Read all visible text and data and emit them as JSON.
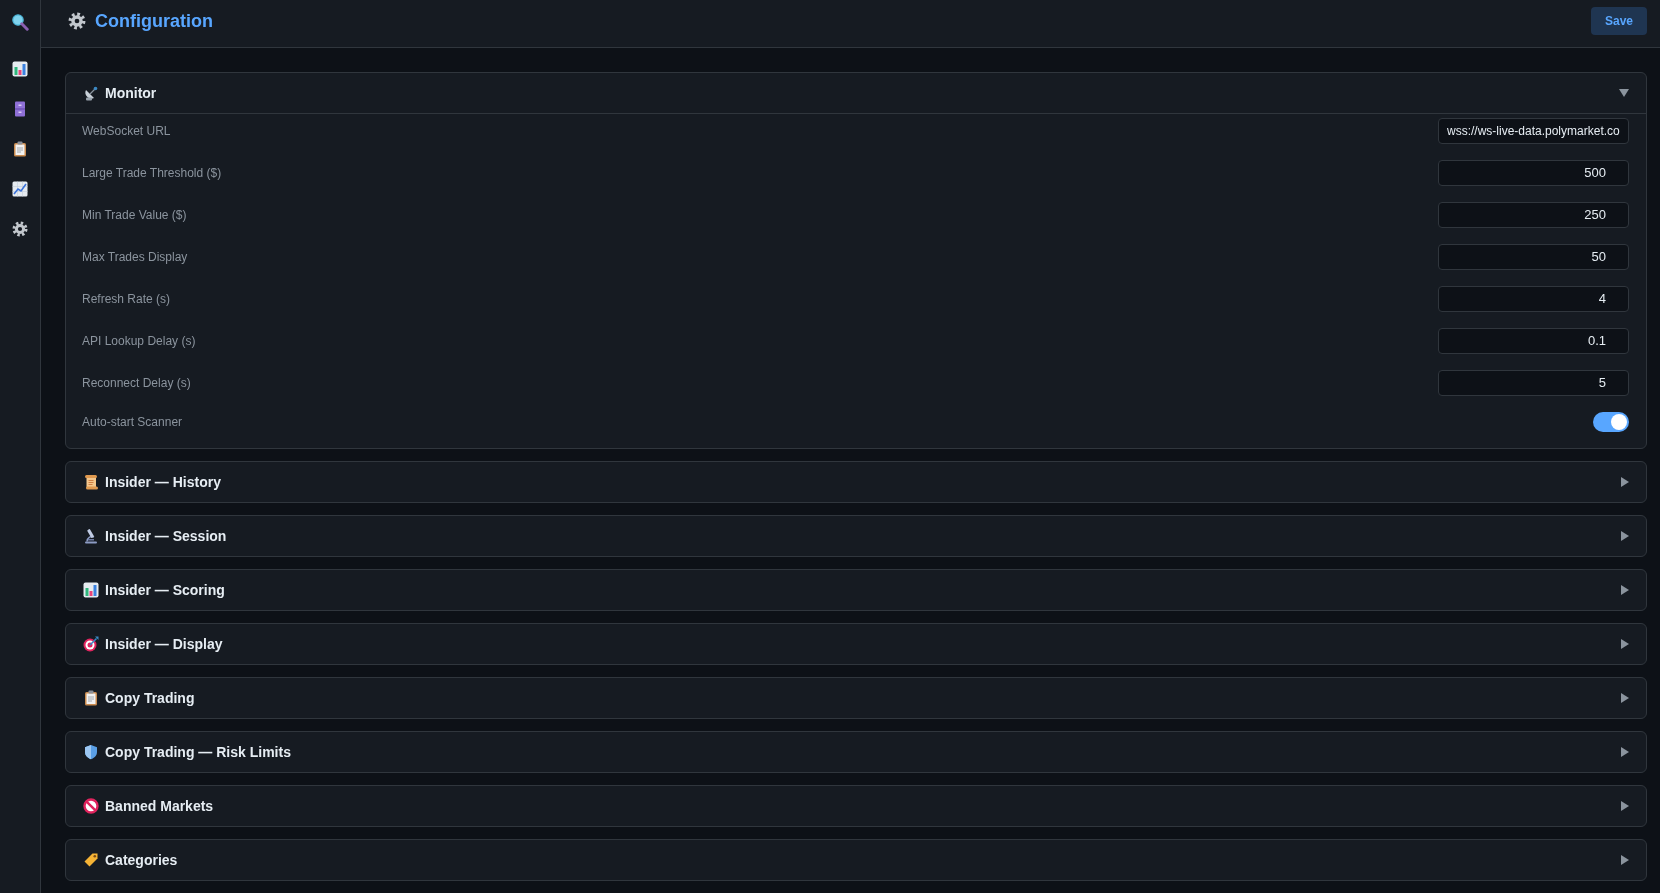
{
  "header": {
    "title": "Configuration",
    "save_button": "Save"
  },
  "sections": [
    {
      "title": "Monitor",
      "expanded": true,
      "fields": [
        {
          "kind": "text",
          "label": "WebSocket URL",
          "value": "wss://ws-live-data.polymarket.co"
        },
        {
          "kind": "number",
          "label": "Large Trade Threshold ($)",
          "value": "500"
        },
        {
          "kind": "number",
          "label": "Min Trade Value ($)",
          "value": "250"
        },
        {
          "kind": "number",
          "label": "Max Trades Display",
          "value": "50"
        },
        {
          "kind": "number",
          "label": "Refresh Rate (s)",
          "value": "4"
        },
        {
          "kind": "number",
          "label": "API Lookup Delay (s)",
          "value": "0.1"
        },
        {
          "kind": "number",
          "label": "Reconnect Delay (s)",
          "value": "5"
        },
        {
          "kind": "toggle",
          "label": "Auto-start Scanner",
          "on": true
        }
      ]
    },
    {
      "title": "Insider — History",
      "expanded": false
    },
    {
      "title": "Insider — Session",
      "expanded": false
    },
    {
      "title": "Insider — Scoring",
      "expanded": false
    },
    {
      "title": "Insider — Display",
      "expanded": false
    },
    {
      "title": "Copy Trading",
      "expanded": false
    },
    {
      "title": "Copy Trading — Risk Limits",
      "expanded": false
    },
    {
      "title": "Banned Markets",
      "expanded": false
    },
    {
      "title": "Categories",
      "expanded": false
    }
  ]
}
